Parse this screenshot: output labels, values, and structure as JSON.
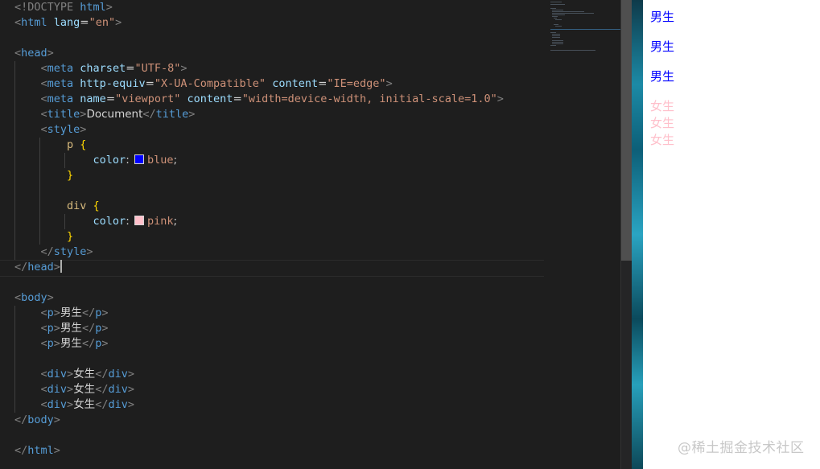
{
  "editor": {
    "lines": {
      "l1": {
        "a": "<!DOCTYPE ",
        "b": "html",
        "c": ">"
      },
      "l2": {
        "a": "<",
        "b": "html",
        "c": " lang",
        "d": "=",
        "e": "\"en\"",
        "f": ">"
      },
      "l4": {
        "a": "<",
        "b": "head",
        "c": ">"
      },
      "l5": {
        "a": "<",
        "b": "meta",
        "c": " charset",
        "d": "=",
        "e": "\"UTF-8\"",
        "f": ">"
      },
      "l6": {
        "a": "<",
        "b": "meta",
        "c": " http-equiv",
        "d": "=",
        "e": "\"X-UA-Compatible\"",
        "g": " content",
        "h": "=",
        "i": "\"IE=edge\"",
        "f": ">"
      },
      "l7": {
        "a": "<",
        "b": "meta",
        "c": " name",
        "d": "=",
        "e": "\"viewport\"",
        "g": " content",
        "h": "=",
        "i": "\"width=device-width, initial-scale=1.0\"",
        "f": ">"
      },
      "l8": {
        "a": "<",
        "b": "title",
        "c": ">",
        "t": "Document",
        "d": "</",
        "e": "title",
        "f": ">"
      },
      "l9": {
        "a": "<",
        "b": "style",
        "c": ">"
      },
      "l10": {
        "sel": "p ",
        "br": "{"
      },
      "l11": {
        "prop": "color",
        "colon": ": ",
        "val": "blue",
        "semi": ";",
        "swatch": "#0000ff"
      },
      "l12": {
        "br": "}"
      },
      "l14": {
        "sel": "div ",
        "br": "{"
      },
      "l15": {
        "prop": "color",
        "colon": ": ",
        "val": "pink",
        "semi": ";",
        "swatch": "#ffc0cb"
      },
      "l16": {
        "br": "}"
      },
      "l17": {
        "a": "</",
        "b": "style",
        "c": ">"
      },
      "l18": {
        "a": "</",
        "b": "head",
        "c": ">"
      },
      "l20": {
        "a": "<",
        "b": "body",
        "c": ">"
      },
      "l21": {
        "a": "<",
        "b": "p",
        "c": ">",
        "t": "男生",
        "d": "</",
        "e": "p",
        "f": ">"
      },
      "l22": {
        "a": "<",
        "b": "p",
        "c": ">",
        "t": "男生",
        "d": "</",
        "e": "p",
        "f": ">"
      },
      "l23": {
        "a": "<",
        "b": "p",
        "c": ">",
        "t": "男生",
        "d": "</",
        "e": "p",
        "f": ">"
      },
      "l25": {
        "a": "<",
        "b": "div",
        "c": ">",
        "t": "女生",
        "d": "</",
        "e": "div",
        "f": ">"
      },
      "l26": {
        "a": "<",
        "b": "div",
        "c": ">",
        "t": "女生",
        "d": "</",
        "e": "div",
        "f": ">"
      },
      "l27": {
        "a": "<",
        "b": "div",
        "c": ">",
        "t": "女生",
        "d": "</",
        "e": "div",
        "f": ">"
      },
      "l28": {
        "a": "</",
        "b": "body",
        "c": ">"
      },
      "l30": {
        "a": "</",
        "b": "html",
        "c": ">"
      }
    }
  },
  "preview": {
    "p_items": [
      "男生",
      "男生",
      "男生"
    ],
    "div_items": [
      "女生",
      "女生",
      "女生"
    ],
    "p_color": "#0000ff",
    "div_color": "#ffc0cb"
  },
  "watermark": "@稀土掘金技术社区"
}
